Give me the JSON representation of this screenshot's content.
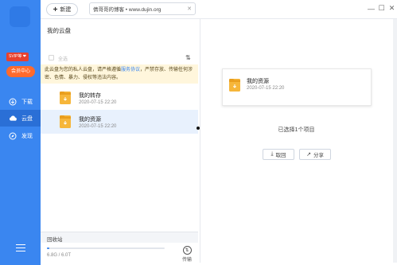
{
  "sidebar": {
    "vip_badge": "SVIP等 ❤",
    "vip_center": "会员中心",
    "nav": [
      {
        "label": "下载",
        "icon": "download-icon"
      },
      {
        "label": "云盘",
        "icon": "cloud-icon"
      },
      {
        "label": "发现",
        "icon": "discover-icon"
      }
    ]
  },
  "toolbar": {
    "new_label": "新建",
    "url": "倩哥哥的博客 • www.dujin.org"
  },
  "list": {
    "title": "我的云盘",
    "select_all": "全选",
    "notice": "此云盘为您的私人云盘，请严格遵循",
    "notice_link": "服务协议",
    "notice_rest": "，严禁存放、传输任何涉密、色情、暴力、侵权等违法内容。",
    "items": [
      {
        "name": "我的转存",
        "date": "2020-07-15 22:20"
      },
      {
        "name": "我的资源",
        "date": "2020-07-15 22:20"
      }
    ]
  },
  "recycle_label": "回收站",
  "storage": {
    "text": "6.8G / 6.0T",
    "used_fraction": 0.02
  },
  "transfer_label": "传输",
  "detail": {
    "name": "我的资源",
    "date": "2020-07-15 22:20",
    "selected_text": "已选择1个项目",
    "btn_download": "取回",
    "btn_share": "分享"
  },
  "colors": {
    "accent": "#3a86f0",
    "folder": "#f6b63a",
    "vip": "#ff6a2c"
  }
}
